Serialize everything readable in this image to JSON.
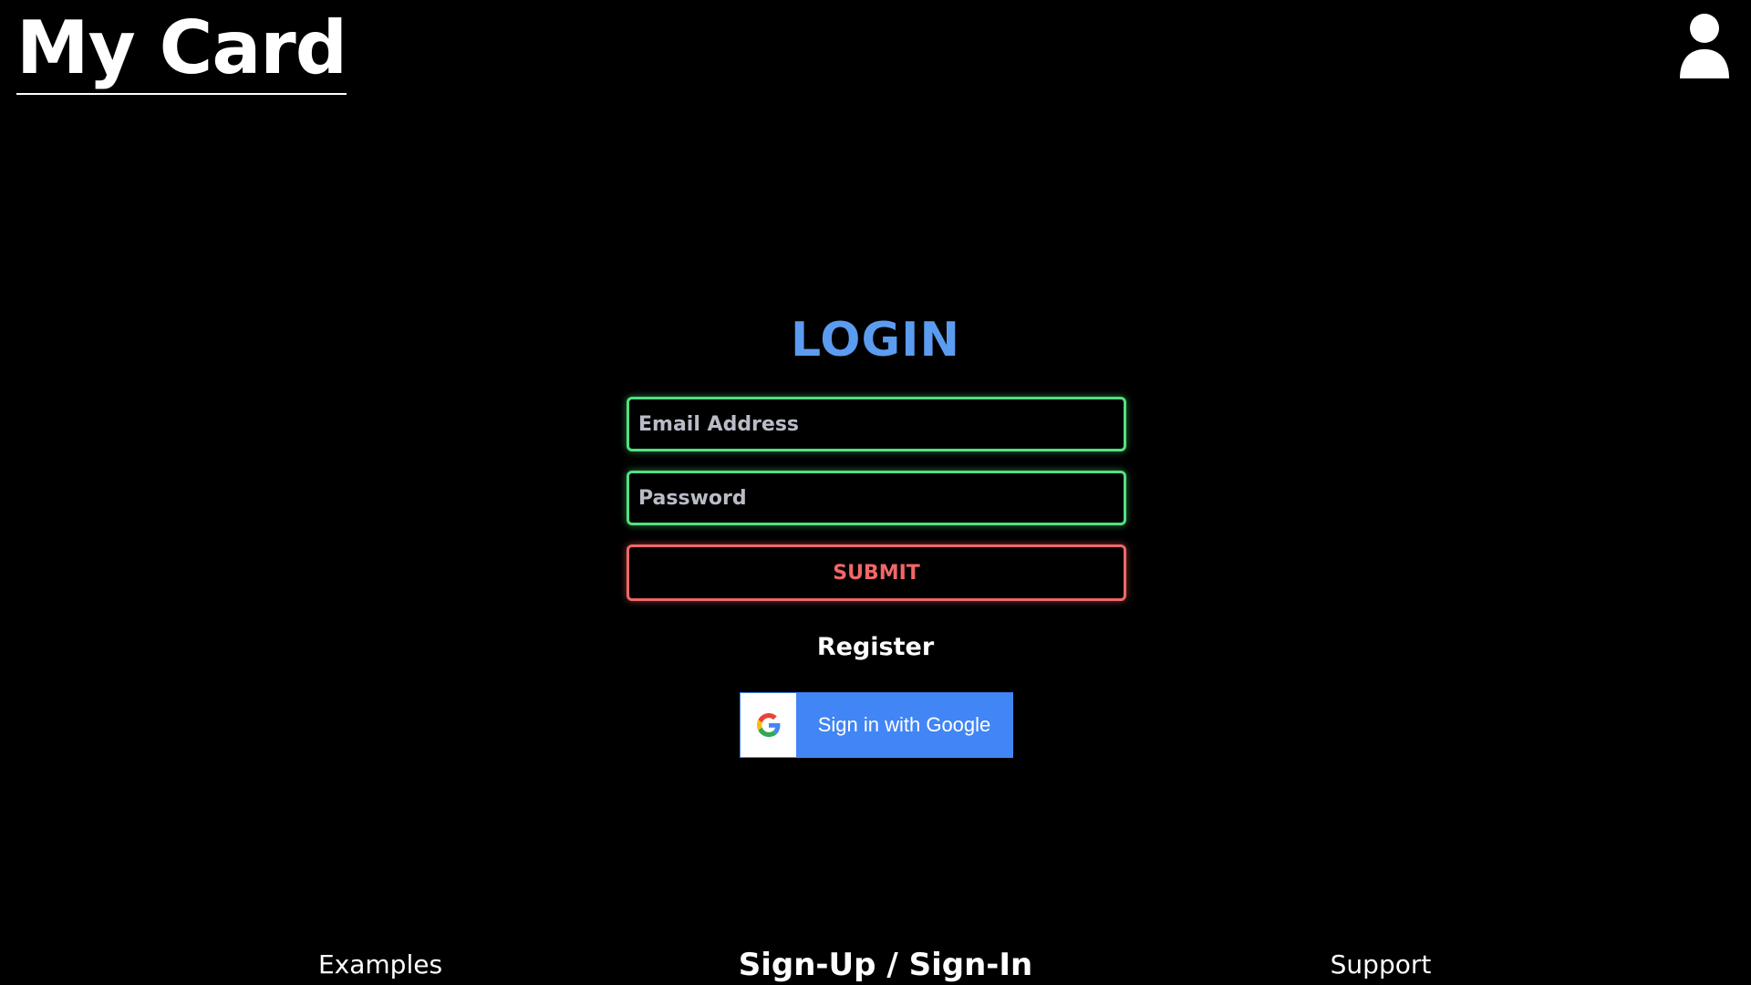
{
  "header": {
    "brand": "My Card",
    "user_icon": "user-icon"
  },
  "login": {
    "title": "LOGIN",
    "email_placeholder": "Email Address",
    "password_placeholder": "Password",
    "submit_label": "SUBMIT",
    "register_label": "Register",
    "google_label": "Sign in with Google"
  },
  "footer": {
    "examples": "Examples",
    "signup": "Sign-Up / Sign-In",
    "support": "Support"
  },
  "colors": {
    "background": "#000000",
    "title": "#5b9cf0",
    "field_border": "#52e07f",
    "submit": "#f06767",
    "google_blue": "#4285f4",
    "text": "#ffffff"
  }
}
